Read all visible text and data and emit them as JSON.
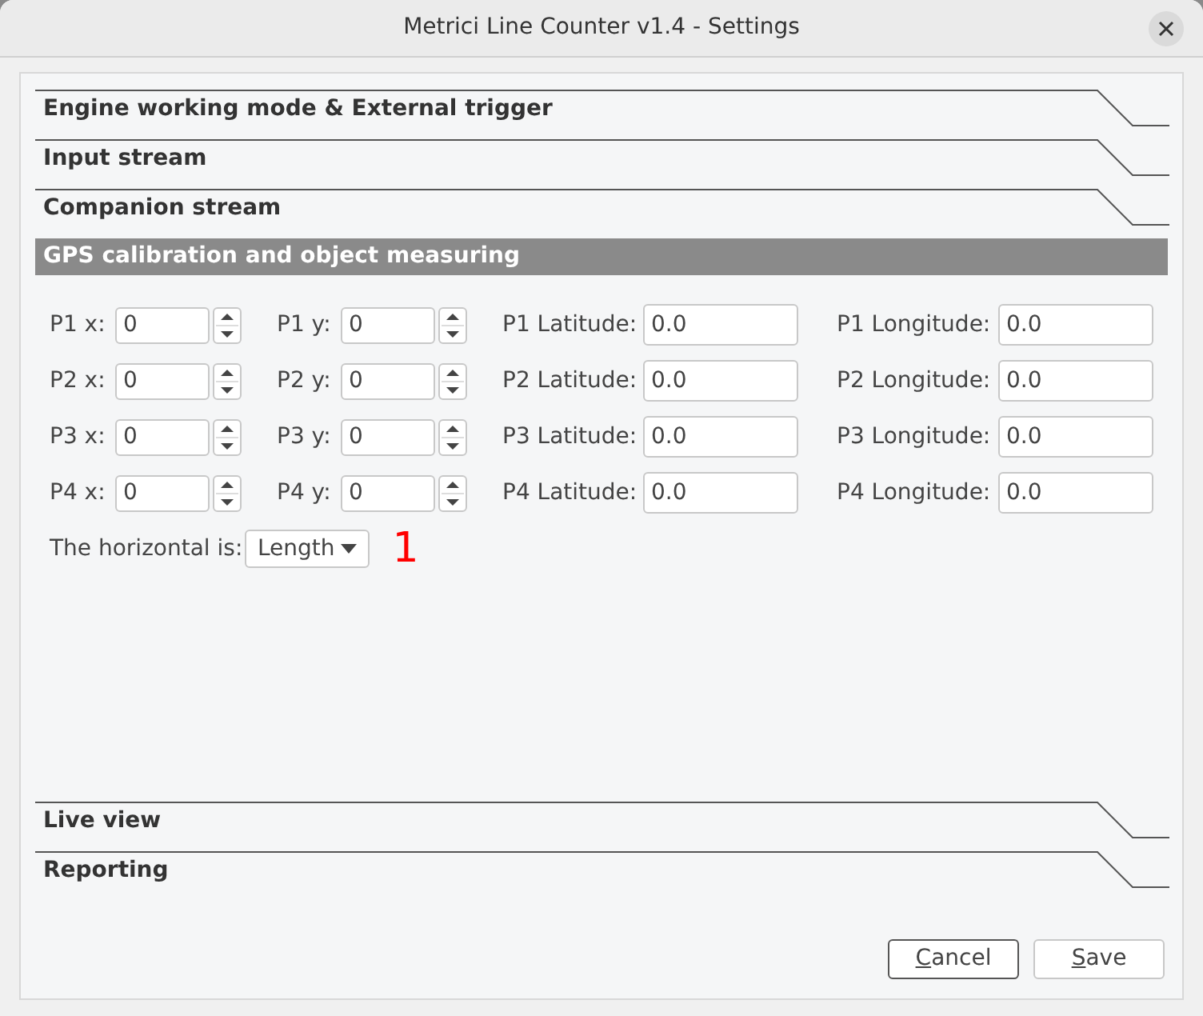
{
  "window": {
    "title": "Metrici Line Counter v1.4 - Settings"
  },
  "sections_top": [
    {
      "title": "Engine working mode & External trigger",
      "expanded": false
    },
    {
      "title": "Input stream",
      "expanded": false
    },
    {
      "title": "Companion stream",
      "expanded": false
    },
    {
      "title": "GPS calibration and object measuring",
      "expanded": true
    }
  ],
  "gps": {
    "points": [
      {
        "x_label": "P1 x:",
        "x_value": "0",
        "y_label": "P1 y:",
        "y_value": "0",
        "lat_label": "P1 Latitude:",
        "lat_value": "0.0",
        "lon_label": "P1 Longitude:",
        "lon_value": "0.0"
      },
      {
        "x_label": "P2 x:",
        "x_value": "0",
        "y_label": "P2 y:",
        "y_value": "0",
        "lat_label": "P2 Latitude:",
        "lat_value": "0.0",
        "lon_label": "P2 Longitude:",
        "lon_value": "0.0"
      },
      {
        "x_label": "P3 x:",
        "x_value": "0",
        "y_label": "P3 y:",
        "y_value": "0",
        "lat_label": "P3 Latitude:",
        "lat_value": "0.0",
        "lon_label": "P3 Longitude:",
        "lon_value": "0.0"
      },
      {
        "x_label": "P4 x:",
        "x_value": "0",
        "y_label": "P4 y:",
        "y_value": "0",
        "lat_label": "P4 Latitude:",
        "lat_value": "0.0",
        "lon_label": "P4 Longitude:",
        "lon_value": "0.0"
      }
    ],
    "horizontal": {
      "label": "The horizontal is:",
      "value": "Length"
    },
    "marker": "1"
  },
  "sections_bottom": [
    {
      "title": "Live view",
      "expanded": false
    },
    {
      "title": "Reporting",
      "expanded": false
    }
  ],
  "buttons": [
    {
      "label": "Cancel",
      "focused": true,
      "mnemonic_first": true
    },
    {
      "label": "Save",
      "focused": false,
      "mnemonic_first": true
    }
  ]
}
